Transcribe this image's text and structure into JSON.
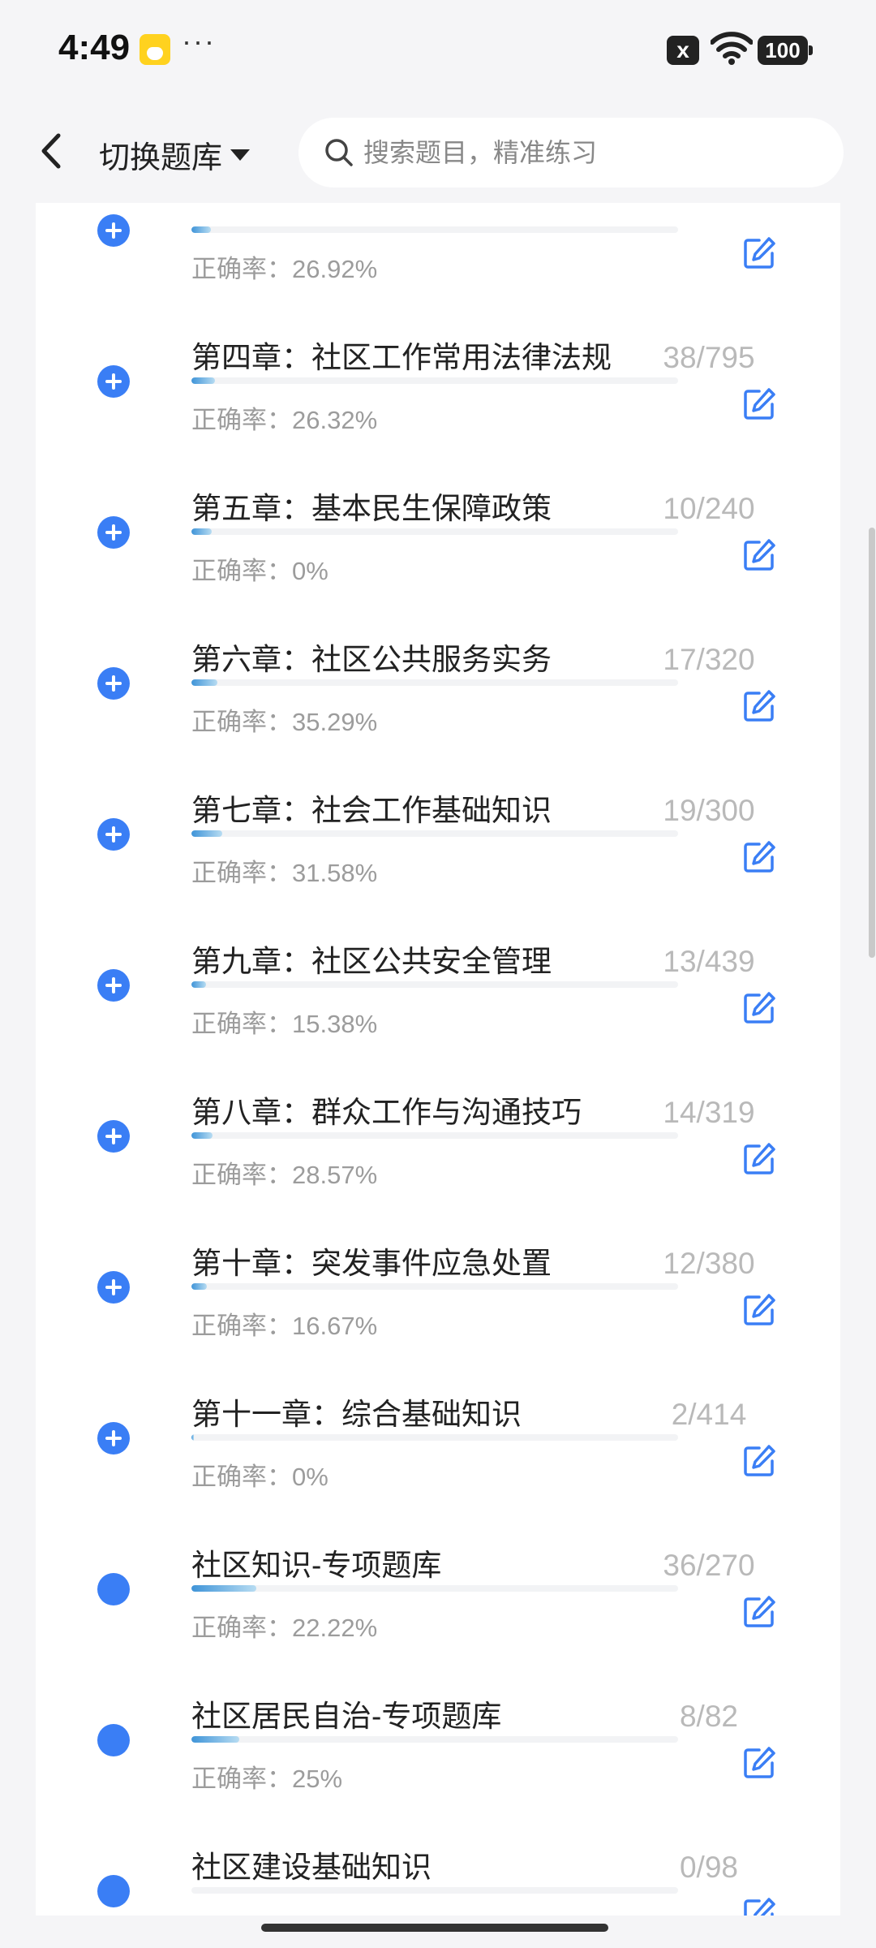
{
  "status_bar": {
    "time": "4:49",
    "app_badge_icon": "app-notification-icon",
    "more": "···",
    "notification_icon": "x",
    "wifi_icon": "wifi-icon",
    "battery": "100"
  },
  "header": {
    "back_icon": "chevron-left-icon",
    "bank_switch": "切换题库",
    "search_placeholder": "搜索题目，精准练习"
  },
  "rate_label": "正确率：",
  "chapters": [
    {
      "title": "",
      "rate": "26.92%",
      "count": "",
      "progress": 0.04,
      "icon": "none"
    },
    {
      "title": "第四章：社区工作常用法律法规",
      "rate": "26.32%",
      "count": "38/795",
      "progress": 0.048,
      "icon": "add"
    },
    {
      "title": "第五章：基本民生保障政策",
      "rate": "0%",
      "count": "10/240",
      "progress": 0.042,
      "icon": "add"
    },
    {
      "title": "第六章：社区公共服务实务",
      "rate": "35.29%",
      "count": "17/320",
      "progress": 0.053,
      "icon": "add"
    },
    {
      "title": "第七章：社会工作基础知识",
      "rate": "31.58%",
      "count": "19/300",
      "progress": 0.063,
      "icon": "add"
    },
    {
      "title": "第九章：社区公共安全管理",
      "rate": "15.38%",
      "count": "13/439",
      "progress": 0.03,
      "icon": "add"
    },
    {
      "title": "第八章：群众工作与沟通技巧",
      "rate": "28.57%",
      "count": "14/319",
      "progress": 0.044,
      "icon": "add"
    },
    {
      "title": "第十章：突发事件应急处置",
      "rate": "16.67%",
      "count": "12/380",
      "progress": 0.032,
      "icon": "add"
    },
    {
      "title": "第十一章：综合基础知识",
      "rate": "0%",
      "count": "2/414",
      "progress": 0.005,
      "icon": "add"
    },
    {
      "title": "社区知识-专项题库",
      "rate": "22.22%",
      "count": "36/270",
      "progress": 0.133,
      "icon": "dot"
    },
    {
      "title": "社区居民自治-专项题库",
      "rate": "25%",
      "count": "8/82",
      "progress": 0.098,
      "icon": "dot"
    },
    {
      "title": "社区建设基础知识",
      "rate": "",
      "count": "0/98",
      "progress": 0.0,
      "icon": "dot"
    }
  ],
  "colors": {
    "accent": "#3a7ef5",
    "progress": "#3f94d8",
    "muted": "#9c9c9c"
  }
}
